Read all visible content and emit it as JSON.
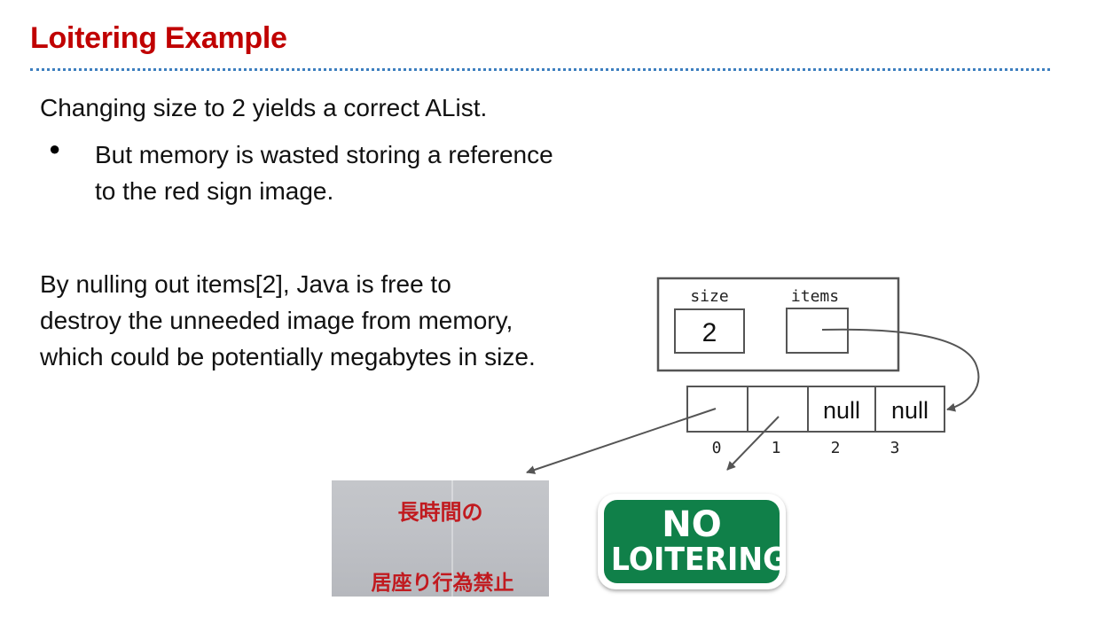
{
  "slide": {
    "title": "Loitering Example",
    "para1": "Changing size to 2 yields a correct AList.",
    "bullet_symbol": "●",
    "bullet1": "But memory is wasted storing a reference to the red sign image.",
    "para2": "By nulling out items[2], Java is free to destroy the unneeded image from memory, which could be potentially megabytes in size."
  },
  "diagram": {
    "size_label": "size",
    "items_label": "items",
    "size_value": "2",
    "cells": [
      "",
      "",
      "null",
      "null"
    ],
    "indices": [
      "0",
      "1",
      "2",
      "3"
    ]
  },
  "images": {
    "jp_sign_line1": "長時間の",
    "jp_sign_line2": "居座り行為禁止",
    "green_sign_line1": "NO",
    "green_sign_line2": "LOITERING"
  },
  "colors": {
    "title": "#c00000",
    "rule": "#3d7fbf",
    "green_sign": "#108049",
    "jp_text": "#c11a1f"
  }
}
